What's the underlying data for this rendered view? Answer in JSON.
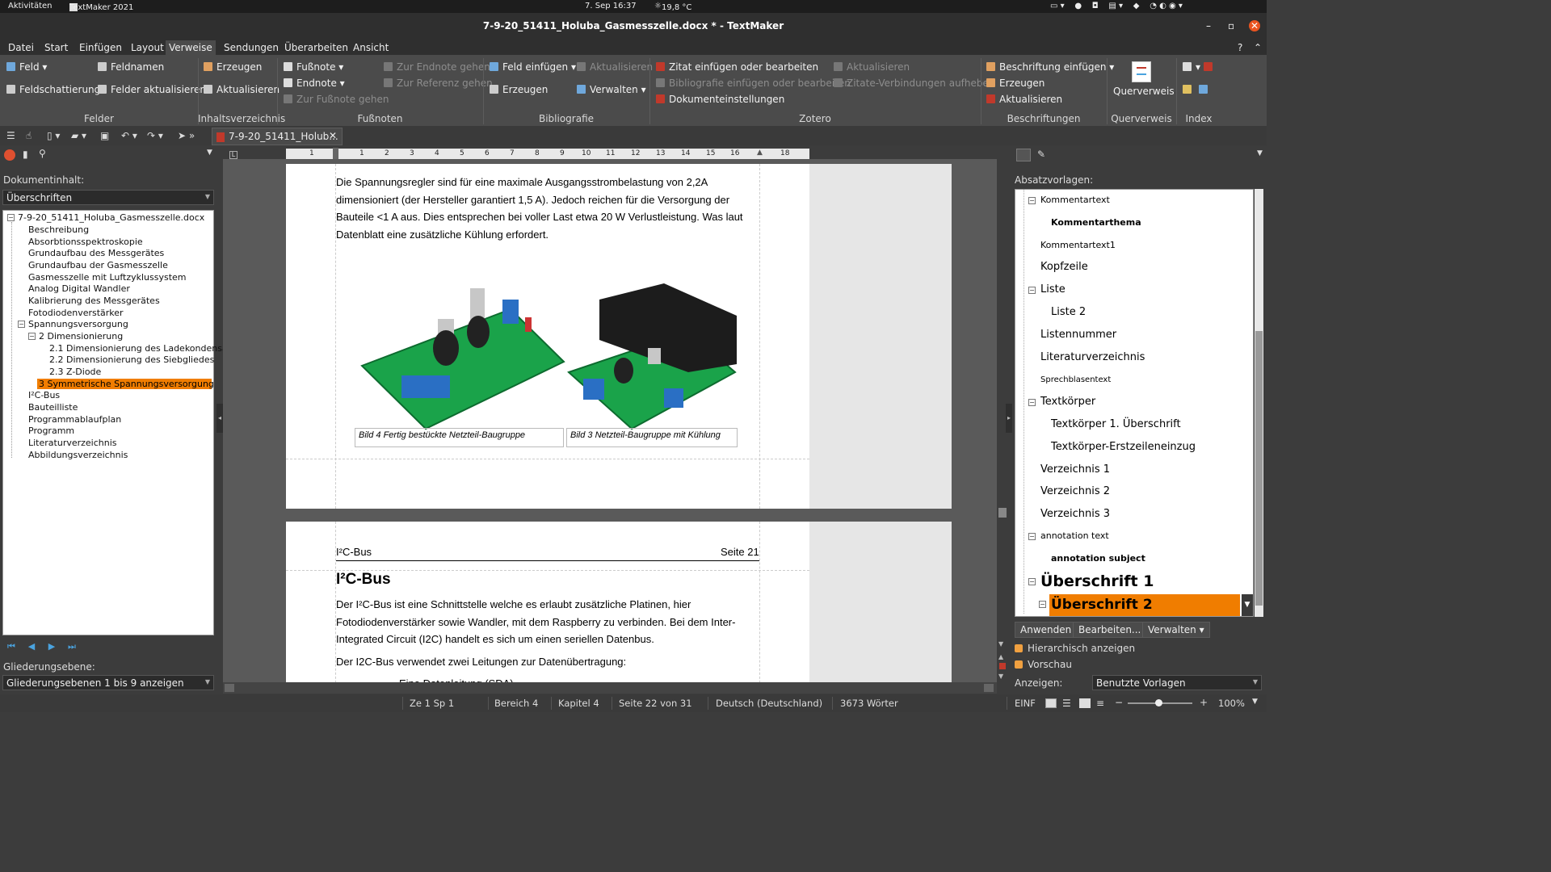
{
  "system": {
    "activities": "Aktivitäten",
    "app": "TextMaker 2021",
    "datetime": "7. Sep  16:37",
    "weather": "19,8 °C"
  },
  "window": {
    "title": "7-9-20_51411_Holuba_Gasmesszelle.docx * - TextMaker"
  },
  "menu": [
    "Datei",
    "Start",
    "Einfügen",
    "Layout",
    "Verweise",
    "Sendungen",
    "Überarbeiten",
    "Ansicht"
  ],
  "ribbon": {
    "feld": "Feld",
    "feldnamen": "Feldnamen",
    "feldschattierung": "Feldschattierung",
    "felder_aktualisieren": "Felder aktualisieren",
    "erzeugen": "Erzeugen",
    "aktualisieren": "Aktualisieren",
    "fussnote": "Fußnote",
    "endnote": "Endnote",
    "zur_fussnote": "Zur Fußnote gehen",
    "zur_endnote": "Zur Endnote gehen",
    "zur_referenz": "Zur Referenz gehen",
    "feld_einfuegen": "Feld einfügen",
    "bib_aktualisieren": "Aktualisieren",
    "bib_erzeugen": "Erzeugen",
    "verwalten": "Verwalten",
    "zitat": "Zitat einfügen oder bearbeiten",
    "bibliografie": "Bibliografie einfügen oder bearbeiten",
    "dokumenteinstellungen": "Dokumenteinstellungen",
    "z_aktualisieren": "Aktualisieren",
    "zitate_verbindungen": "Zitate-Verbindungen aufheben",
    "beschriftung": "Beschriftung einfügen",
    "b_erzeugen": "Erzeugen",
    "b_aktualisieren": "Aktualisieren",
    "querverweis": "Querverweis",
    "groups": {
      "felder": "Felder",
      "inhalt": "Inhaltsverzeichnis",
      "fussnoten": "Fußnoten",
      "bibliografie": "Bibliografie",
      "zotero": "Zotero",
      "beschriftungen": "Beschriftungen",
      "querverweis": "Querverweis",
      "index": "Index"
    }
  },
  "doctab": "7-9-20_51411_Holub...",
  "ruler": [
    "1",
    "1",
    "2",
    "3",
    "4",
    "5",
    "6",
    "7",
    "8",
    "9",
    "10",
    "11",
    "12",
    "13",
    "14",
    "15",
    "16",
    "18"
  ],
  "nav": {
    "label": "Dokumentinhalt:",
    "filter": "Überschriften",
    "root": "7-9-20_51411_Holuba_Gasmesszelle.docx",
    "items": [
      "Beschreibung",
      "Absorbtionsspektroskopie",
      "Grundaufbau des Messgerätes",
      "Grundaufbau der Gasmesszelle",
      "Gasmesszelle mit Luftzyklussystem",
      "Analog Digital Wandler",
      "Kalibrierung des Messgerätes",
      "Fotodiodenverstärker",
      "Spannungsversorgung"
    ],
    "sub": "2 Dimensionierung",
    "subsub": [
      "2.1 Dimensionierung des Ladekondensa",
      "2.2 Dimensionierung des Siebgliedes",
      "2.3 Z-Diode"
    ],
    "selected": "3 Symmetrische Spannungsversorgung",
    "after": [
      "I²C-Bus",
      "Bauteilliste",
      "Programmablaufplan",
      "Programm",
      "Literaturverzeichnis",
      "Abbildungsverzeichnis"
    ],
    "level_label": "Gliederungsebene:",
    "level_value": "Gliederungsebenen 1 bis 9 anzeigen"
  },
  "page1": {
    "lines": [
      "Die Spannungsregler sind für eine maximale Ausgangsstrombelastung von 2,2A",
      "dimensioniert (der Hersteller garantiert 1,5 A). Jedoch reichen für die Versorgung der",
      "Bauteile <1 A aus. Dies entsprechen bei voller Last etwa 20 W Verlustleistung. Was laut",
      "Datenblatt eine zusätzliche Kühlung erfordert."
    ],
    "caption1": "Bild 4 Fertig bestückte Netzteil-Baugruppe",
    "caption2": "Bild 3 Netzteil-Baugruppe mit Kühlung"
  },
  "page2": {
    "header_left": "I²C-Bus",
    "header_right": "Seite 21",
    "heading": "I²C-Bus",
    "lines": [
      "Der I²C-Bus ist eine Schnittstelle welche es erlaubt zusätzliche Platinen, hier",
      "Fotodiodenverstärker sowie Wandler, mit dem Raspberry zu verbinden. Bei dem Inter-",
      "Integrated Circuit (I2C) handelt es sich um einen seriellen Datenbus."
    ],
    "line2": "Der I2C-Bus verwendet zwei Leitungen zur Datenübertragung:",
    "partial": "Eine Datenleitung (SDA)"
  },
  "styles": {
    "label": "Absatzvorlagen:",
    "items": [
      "Kommentartext",
      "Kommentarthema",
      "Kommentartext1",
      "Kopfzeile",
      "Liste",
      "Liste 2",
      "Listennummer",
      "Literaturverzeichnis",
      "Sprechblasentext",
      "Textkörper",
      "Textkörper 1. Überschrift",
      "Textkörper-Erstzeileneinzug",
      "Verzeichnis 1",
      "Verzeichnis 2",
      "Verzeichnis 3",
      "annotation text",
      "annotation subject",
      "Überschrift 1",
      "Überschrift 2"
    ],
    "apply": "Anwenden",
    "edit": "Bearbeiten...",
    "manage": "Verwalten",
    "hier": "Hierarchisch anzeigen",
    "preview": "Vorschau",
    "show_label": "Anzeigen:",
    "show_value": "Benutzte Vorlagen"
  },
  "status": {
    "pos": "Ze 1 Sp 1",
    "bereich": "Bereich 4",
    "kapitel": "Kapitel 4",
    "seite": "Seite 22 von 31",
    "lang": "Deutsch (Deutschland)",
    "words": "3673 Wörter",
    "mode": "EINF",
    "zoom": "100%"
  }
}
